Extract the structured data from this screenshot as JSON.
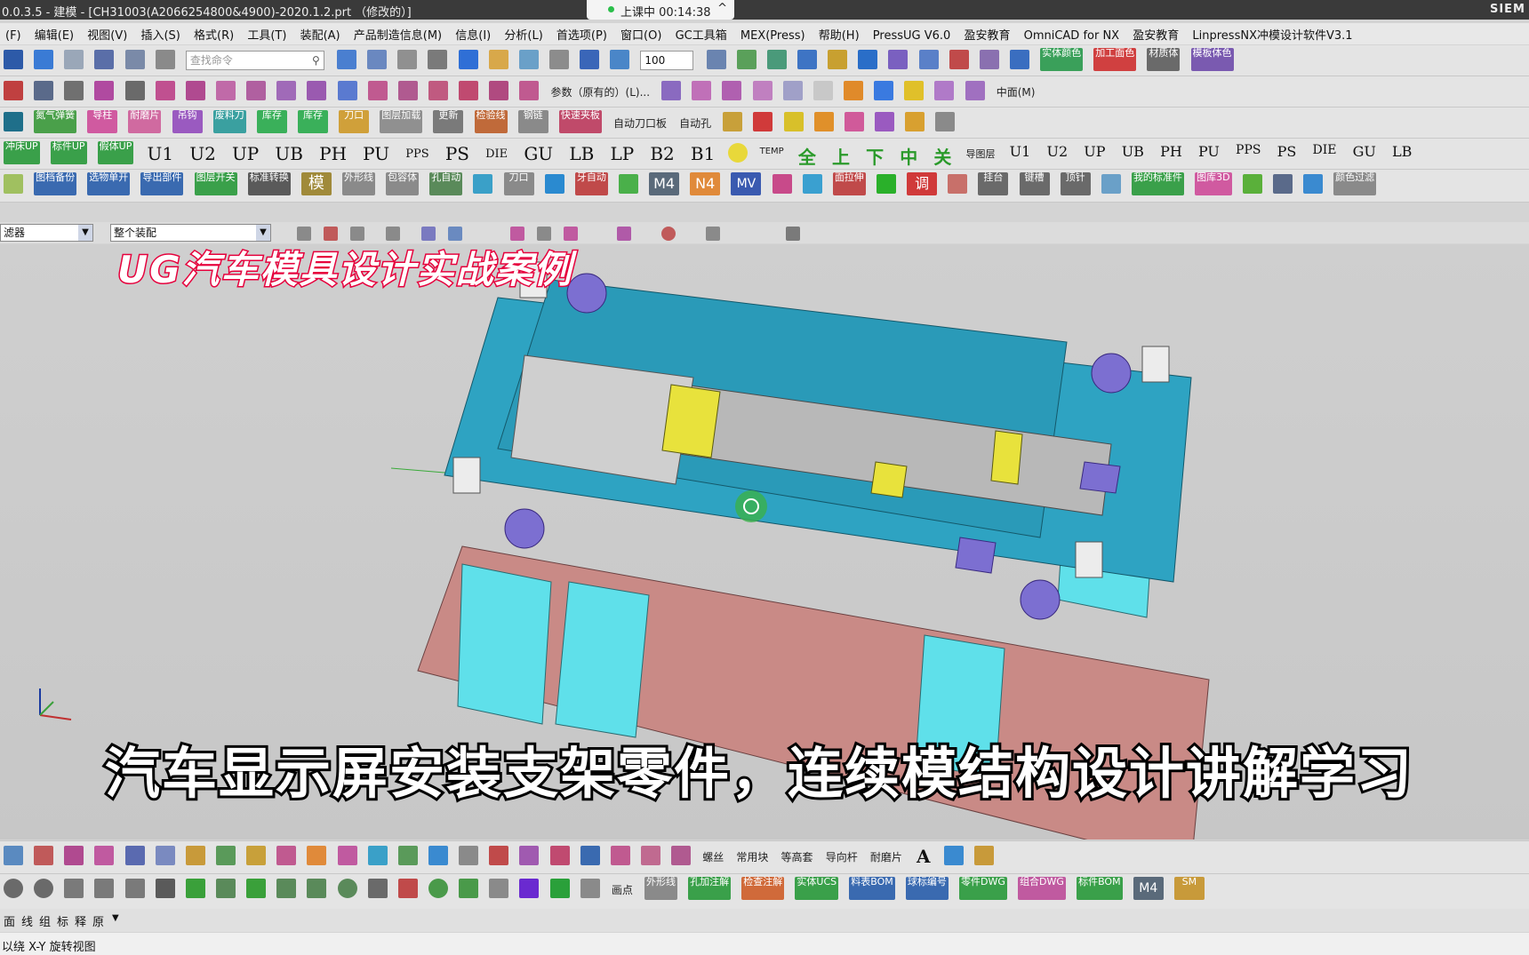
{
  "window": {
    "title": "0.0.3.5 - 建模 - [CH31003(A2066254800&4900)-2020.1.2.prt （修改的）]",
    "brand": "SIEM",
    "timer_label": "上课中 00:14:38",
    "timer_chevron": "^"
  },
  "menu": [
    "(F)",
    "编辑(E)",
    "视图(V)",
    "插入(S)",
    "格式(R)",
    "工具(T)",
    "装配(A)",
    "产品制造信息(M)",
    "信息(I)",
    "分析(L)",
    "首选项(P)",
    "窗口(O)",
    "GC工具箱",
    "MEX(Press)",
    "帮助(H)",
    "PressUG V6.0",
    "盈安教育",
    "OmniCAD for NX",
    "盈安教育",
    "LinpressNX冲模设计软件V3.1"
  ],
  "toolbar1": {
    "search_placeholder": "查找命令",
    "zoom": "100",
    "labels": [
      "实体颜色",
      "加工面色",
      "材质体",
      "模板体色"
    ]
  },
  "toolbar2": {
    "labels": [
      "参数（原有的）(L)...",
      "中面(M)"
    ]
  },
  "toolbar3": {
    "tags": [
      "氮气弹簧",
      "导柱",
      "耐磨片",
      "吊钩",
      "废料刀",
      "库存",
      "库存",
      "刀口",
      "图层加载",
      "更新",
      "检验线",
      "钢链",
      "快速夹板"
    ],
    "labels": [
      "自动刀口板",
      "自动孔"
    ]
  },
  "toolbar4": {
    "tags": [
      "冲床UP",
      "标件UP",
      "假体UP"
    ],
    "codes": [
      "U1",
      "U2",
      "UP",
      "UB",
      "PH",
      "PU",
      "PPS",
      "PS",
      "DIE",
      "GU",
      "LB",
      "LP",
      "B2",
      "B1"
    ],
    "chars": [
      "全",
      "上",
      "下",
      "中",
      "关"
    ],
    "small": [
      "TEMP",
      "导图层"
    ],
    "codes2": [
      "U1",
      "U2",
      "UP",
      "UB",
      "PH",
      "PU",
      "PPS",
      "PS",
      "DIE",
      "GU",
      "LB"
    ]
  },
  "toolbar5": {
    "tags": [
      "图档备份",
      "选物单开",
      "导出部件",
      "图层开关",
      "标准转换",
      "模",
      "外形线",
      "包容体",
      "孔自动",
      "刀口",
      "牙自动",
      "M4",
      "N4",
      "MV",
      "面拉伸",
      "调",
      "挂台",
      "键槽",
      "顶针",
      "我的标准件",
      "图库3D",
      "颜色过滤"
    ]
  },
  "selection": {
    "filter": "滤器",
    "scope": "整个装配"
  },
  "captions": {
    "top": "UG汽车模具设计实战案例",
    "bottom": "汽车显示屏安装支架零件，连续模结构设计讲解学习"
  },
  "bottom_toolbar1": {
    "labels": [
      "螺丝",
      "常用块",
      "等高套",
      "导向杆",
      "耐磨片"
    ],
    "letter": "A"
  },
  "bottom_toolbar2": {
    "labels": [
      "画点",
      "外形线"
    ],
    "tags": [
      "孔加注解",
      "检查注解",
      "实体UCS",
      "料表BOM",
      "球标编号",
      "零件DWG",
      "组合DWG",
      "标件BOM",
      "M4",
      "SM"
    ]
  },
  "line_tabs": [
    "面",
    "线",
    "组",
    "标",
    "释",
    "原"
  ],
  "status": "以绕 X-Y 旋转视图",
  "colors": {
    "plate": "#2ea3c2",
    "pink": "#c98a86",
    "cyan": "#5fe0ea",
    "purple": "#7c6fd1",
    "yellow": "#e8e23c"
  }
}
